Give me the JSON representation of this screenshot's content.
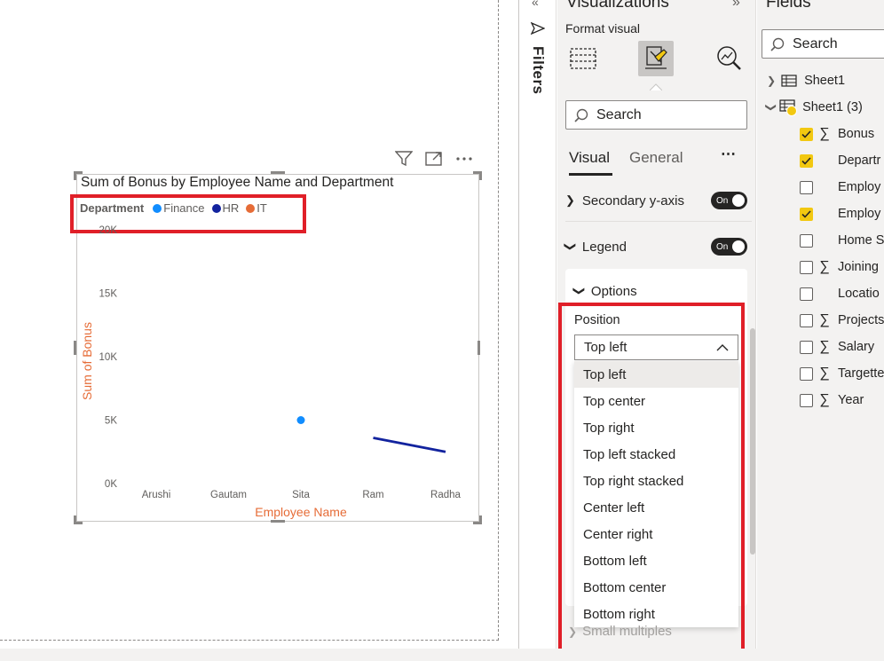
{
  "visual": {
    "title": "Sum of Bonus by Employee Name and Department",
    "legend": {
      "title": "Department",
      "items": [
        {
          "label": "Finance",
          "color": "#118dff"
        },
        {
          "label": "HR",
          "color": "#12239e"
        },
        {
          "label": "IT",
          "color": "#e66c37"
        }
      ]
    }
  },
  "chart_data": {
    "type": "line",
    "title": "Sum of Bonus by Employee Name and Department",
    "xlabel": "Employee Name",
    "ylabel": "Sum of Bonus",
    "categories": [
      "Arushi",
      "Gautam",
      "Sita",
      "Ram",
      "Radha"
    ],
    "y_ticks": [
      "0K",
      "5K",
      "10K",
      "15K",
      "20K"
    ],
    "ylim": [
      0,
      20000
    ],
    "legend_position": "top-left",
    "series": [
      {
        "name": "Finance",
        "color": "#118dff",
        "values": [
          null,
          null,
          5000,
          null,
          null
        ]
      },
      {
        "name": "HR",
        "color": "#12239e",
        "values": [
          null,
          null,
          null,
          3600,
          2500
        ]
      },
      {
        "name": "IT",
        "color": "#e66c37",
        "values": [
          null,
          null,
          null,
          null,
          null
        ]
      }
    ]
  },
  "filters_pane": {
    "label": "Filters"
  },
  "visualizations_pane": {
    "title": "Visualizations",
    "format_label": "Format visual",
    "search_placeholder": "Search",
    "tabs": [
      "Visual",
      "General"
    ],
    "more_label": "⋯",
    "sections": {
      "secondary_y": "Secondary y-axis",
      "legend": "Legend",
      "options": "Options",
      "small_multiples": "Small multiples"
    },
    "toggle_on": "On",
    "position_label": "Position",
    "position_selected": "Top left",
    "position_options": [
      "Top left",
      "Top center",
      "Top right",
      "Top left stacked",
      "Top right stacked",
      "Center left",
      "Center right",
      "Bottom left",
      "Bottom center",
      "Bottom right"
    ]
  },
  "fields_pane": {
    "title": "Fields",
    "search_placeholder": "Search",
    "tables": [
      "Sheet1",
      "Sheet1 (3)"
    ],
    "fields": [
      {
        "label": "Bonus",
        "sigma": true,
        "checked": true
      },
      {
        "label": "Departr",
        "sigma": false,
        "checked": true
      },
      {
        "label": "Employ",
        "sigma": false,
        "checked": false
      },
      {
        "label": "Employ",
        "sigma": false,
        "checked": true
      },
      {
        "label": "Home S",
        "sigma": false,
        "checked": false
      },
      {
        "label": "Joining",
        "sigma": true,
        "checked": false
      },
      {
        "label": "Locatio",
        "sigma": false,
        "checked": false
      },
      {
        "label": "Projects",
        "sigma": true,
        "checked": false
      },
      {
        "label": "Salary",
        "sigma": true,
        "checked": false
      },
      {
        "label": "Targette",
        "sigma": true,
        "checked": false
      },
      {
        "label": "Year",
        "sigma": true,
        "checked": false
      }
    ]
  }
}
